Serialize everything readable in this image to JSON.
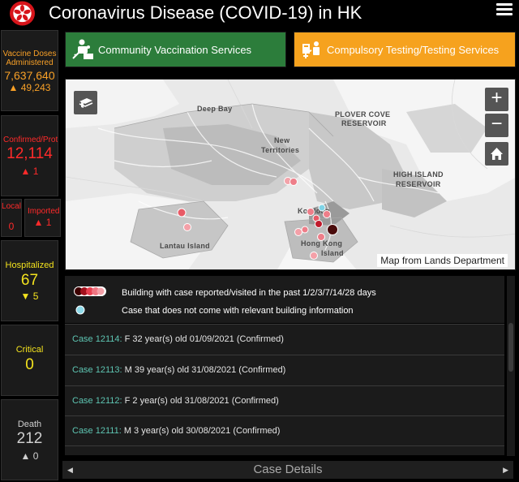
{
  "header": {
    "title": "Coronavirus Disease (COVID-19) in HK"
  },
  "stats": {
    "vaccine": {
      "label_line1": "Vaccine Doses",
      "label_line2": "Administered",
      "value": "7,637,640",
      "change": "▲ 49,243"
    },
    "confirmed": {
      "label": "Confirmed/Prot",
      "value": "12,114",
      "change": "▲ 1"
    },
    "local": {
      "label": "Local",
      "value": "0"
    },
    "imported": {
      "label": "Imported",
      "change": "▲ 1"
    },
    "hospitalized": {
      "label": "Hospitalized",
      "value": "67",
      "change": "▼ 5"
    },
    "critical": {
      "label": "Critical",
      "value": "0"
    },
    "death": {
      "label": "Death",
      "value": "212",
      "change": "▲ 0"
    }
  },
  "actions": {
    "vaccination": "Community Vaccination Services",
    "testing": "Compulsory Testing/Testing Services"
  },
  "map": {
    "labels": {
      "deep_bay": "Deep Bay",
      "plover_cove_1": "PLOVER COVE",
      "plover_cove_2": "RESERVOIR",
      "new_territories_1": "New",
      "new_territories_2": "Territories",
      "high_island_1": "HIGH ISLAND",
      "high_island_2": "RESERVOIR",
      "kowloon": "Kowloon",
      "hong_kong": "Hong Kong",
      "island": "Island",
      "lantau": "Lantau Island"
    },
    "zoom_in": "+",
    "zoom_out": "−",
    "attribution": "Map from Lands Department"
  },
  "legend": {
    "building": "Building with case reported/visited in the past 1/2/3/7/14/28 days",
    "no_building": "Case that does not come with relevant building information"
  },
  "cases": [
    {
      "id": "Case 12114:",
      "info": "F  32 year(s) old  01/09/2021 (Confirmed)"
    },
    {
      "id": "Case 12113:",
      "info": "M  39 year(s) old  31/08/2021 (Confirmed)"
    },
    {
      "id": "Case 12112:",
      "info": "F  2 year(s) old  31/08/2021 (Confirmed)"
    },
    {
      "id": "Case 12111:",
      "info": "M  3 year(s) old  30/08/2021 (Confirmed)"
    }
  ],
  "footer": {
    "label": "Case Details"
  },
  "colors": {
    "vaccination_button": "#2c7d3b",
    "testing_button": "#f6a21e",
    "confirmed": "#ff2a2a",
    "hospitalized": "#f4e31e",
    "vaccine": "#f8a027",
    "case_id": "#5ec6b3"
  }
}
